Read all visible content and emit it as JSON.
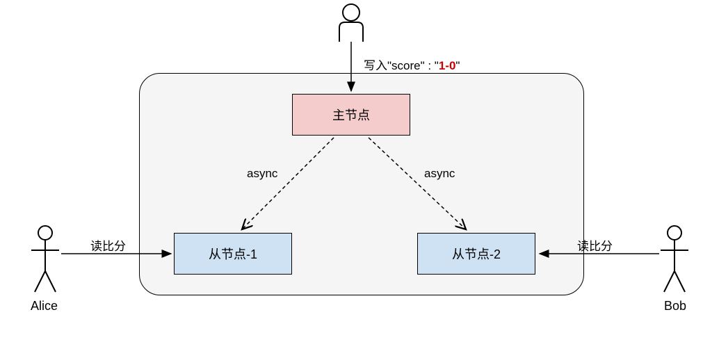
{
  "nodes": {
    "primary": "主节点",
    "replica1": "从节点-1",
    "replica2": "从节点-2"
  },
  "actors": {
    "alice": "Alice",
    "bob": "Bob"
  },
  "labels": {
    "write_prefix": "写入\"score\" : \"",
    "write_value": "1-0",
    "write_suffix": "\"",
    "async": "async",
    "read": "读比分"
  }
}
